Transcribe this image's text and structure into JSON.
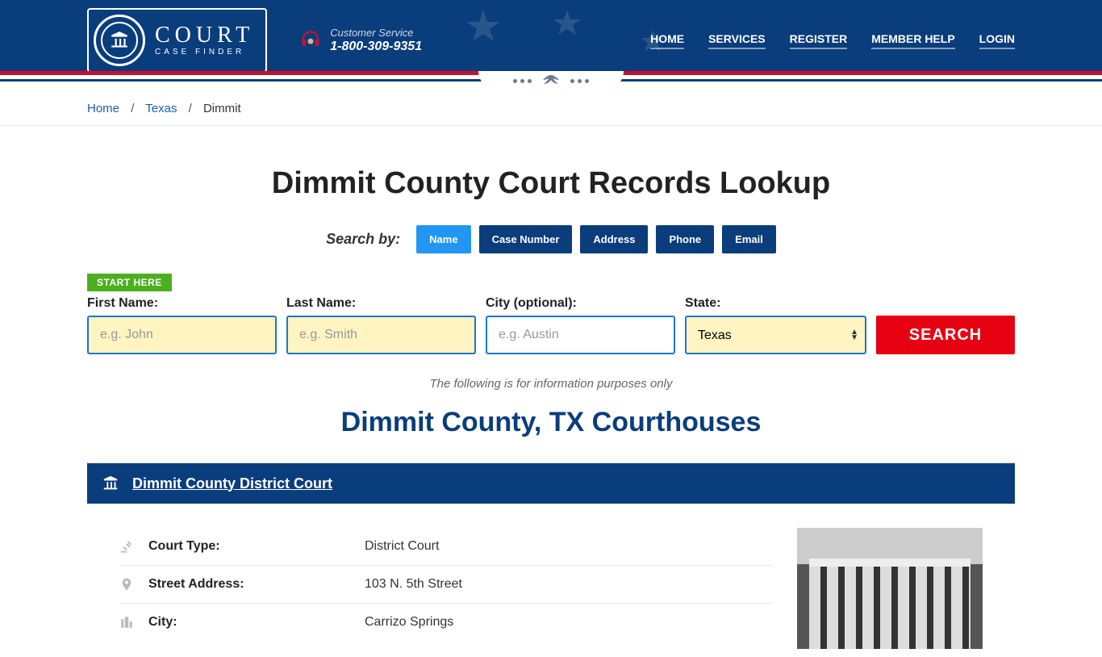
{
  "header": {
    "logo_main": "COURT",
    "logo_sub": "CASE FINDER",
    "cs_label": "Customer Service",
    "cs_phone": "1-800-309-9351",
    "nav": [
      "HOME",
      "SERVICES",
      "REGISTER",
      "MEMBER HELP",
      "LOGIN"
    ]
  },
  "breadcrumb": {
    "home": "Home",
    "state": "Texas",
    "current": "Dimmit"
  },
  "page_title": "Dimmit County Court Records Lookup",
  "search_by_label": "Search by:",
  "search_tabs": [
    "Name",
    "Case Number",
    "Address",
    "Phone",
    "Email"
  ],
  "start_here": "START HERE",
  "form": {
    "first_name_label": "First Name:",
    "first_name_ph": "e.g. John",
    "last_name_label": "Last Name:",
    "last_name_ph": "e.g. Smith",
    "city_label": "City (optional):",
    "city_ph": "e.g. Austin",
    "state_label": "State:",
    "state_value": "Texas",
    "search_btn": "SEARCH"
  },
  "disclaimer": "The following is for information purposes only",
  "section_title": "Dimmit County, TX Courthouses",
  "court": {
    "name": "Dimmit County District Court",
    "rows": [
      {
        "label": "Court Type:",
        "value": "District Court"
      },
      {
        "label": "Street Address:",
        "value": "103 N. 5th Street"
      },
      {
        "label": "City:",
        "value": "Carrizo Springs"
      }
    ]
  }
}
